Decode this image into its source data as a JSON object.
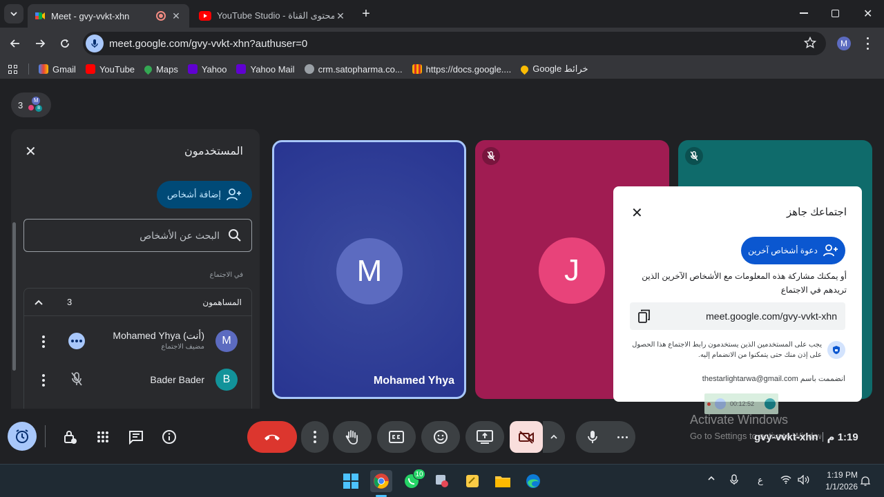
{
  "browser": {
    "tabs": [
      {
        "title": "Meet - gvy-vvkt-xhn",
        "active": true
      },
      {
        "title": "YouTube Studio - محتوى القناة",
        "active": false
      }
    ],
    "url": "meet.google.com/gvy-vvkt-xhn?authuser=0",
    "profile_initial": "M",
    "bookmarks": [
      "Gmail",
      "YouTube",
      "Maps",
      "Yahoo",
      "Yahoo Mail",
      "crm.satopharma.co...",
      "https://docs.google....",
      "Google خرائط"
    ]
  },
  "meet": {
    "participant_count": "3",
    "people_panel": {
      "title": "المستخدمون",
      "add_people_label": "إضافة أشخاص",
      "search_placeholder": "البحث عن الأشخاص",
      "section_label": "في الاجتماع",
      "group_label": "المساهمون",
      "group_count": "3",
      "participants": [
        {
          "initial": "M",
          "name": "Mohamed Yhya (أنت)",
          "role": "مضيف الاجتماع",
          "color": "#5c6bc0"
        },
        {
          "initial": "B",
          "name": "Bader Bader",
          "role": "",
          "color": "#12939a"
        }
      ]
    },
    "tiles": [
      {
        "initial": "M",
        "name": "Mohamed Yhya",
        "color": "#5c6bc0"
      },
      {
        "initial": "J",
        "name": "J",
        "color": "#e8437a"
      }
    ],
    "ready_dialog": {
      "title": "اجتماعك جاهز",
      "invite_label": "دعوة أشخاص آخرين",
      "share_text": "أو يمكنك مشاركة هذه المعلومات مع الأشخاص الآخرين الذين تريدهم في الاجتماع",
      "link": "meet.google.com/gvy-vvkt-xhn",
      "security_note": "يجب على المستخدمين الذين يستخدمون رابط الاجتماع هذا الحصول على إذن منك حتى يتمكنوا من الانضمام إليه.",
      "joined_as": "انضممت باسم thestarlightarwa@gmail.com"
    },
    "recording_timer": "00:12:52",
    "meeting_code": "gvy-vvkt-xhn",
    "clock": "1:19 م",
    "watermark_title": "Activate Windows",
    "watermark_sub": "Go to Settings to activate Windows."
  },
  "taskbar": {
    "whatsapp_badge": "10",
    "lang": "ع",
    "time": "1:19 PM",
    "date": "1/1/2026"
  }
}
